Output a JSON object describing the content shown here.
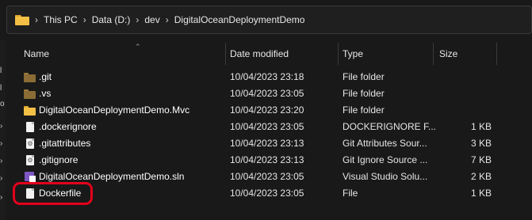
{
  "address_bar": {
    "breadcrumbs": [
      "This PC",
      "Data (D:)",
      "dev",
      "DigitalOceanDeploymentDemo"
    ]
  },
  "columns": {
    "name": "Name",
    "date_modified": "Date modified",
    "type": "Type",
    "size": "Size"
  },
  "files": [
    {
      "name": ".git",
      "date": "10/04/2023 23:18",
      "type": "File folder",
      "size": "",
      "icon": "folder-icon"
    },
    {
      "name": ".vs",
      "date": "10/04/2023 23:05",
      "type": "File folder",
      "size": "",
      "icon": "folder-icon"
    },
    {
      "name": "DigitalOceanDeploymentDemo.Mvc",
      "date": "10/04/2023 23:20",
      "type": "File folder",
      "size": "",
      "icon": "folder-icon"
    },
    {
      "name": ".dockerignore",
      "date": "10/04/2023 23:05",
      "type": "DOCKERIGNORE F...",
      "size": "1 KB",
      "icon": "file-icon"
    },
    {
      "name": ".gitattributes",
      "date": "10/04/2023 23:13",
      "type": "Git Attributes Sour...",
      "size": "3 KB",
      "icon": "settings-file-icon"
    },
    {
      "name": ".gitignore",
      "date": "10/04/2023 23:13",
      "type": "Git Ignore Source ...",
      "size": "7 KB",
      "icon": "settings-file-icon"
    },
    {
      "name": "DigitalOceanDeploymentDemo.sln",
      "date": "10/04/2023 23:05",
      "type": "Visual Studio Solu...",
      "size": "2 KB",
      "icon": "solution-file-icon"
    },
    {
      "name": "Dockerfile",
      "date": "10/04/2023 23:05",
      "type": "File",
      "size": "1 KB",
      "icon": "file-icon"
    }
  ],
  "colors": {
    "background": "#191919",
    "folder": "#f3bf44",
    "folder_dark": "#c9922b",
    "highlight": "#e3001b"
  }
}
